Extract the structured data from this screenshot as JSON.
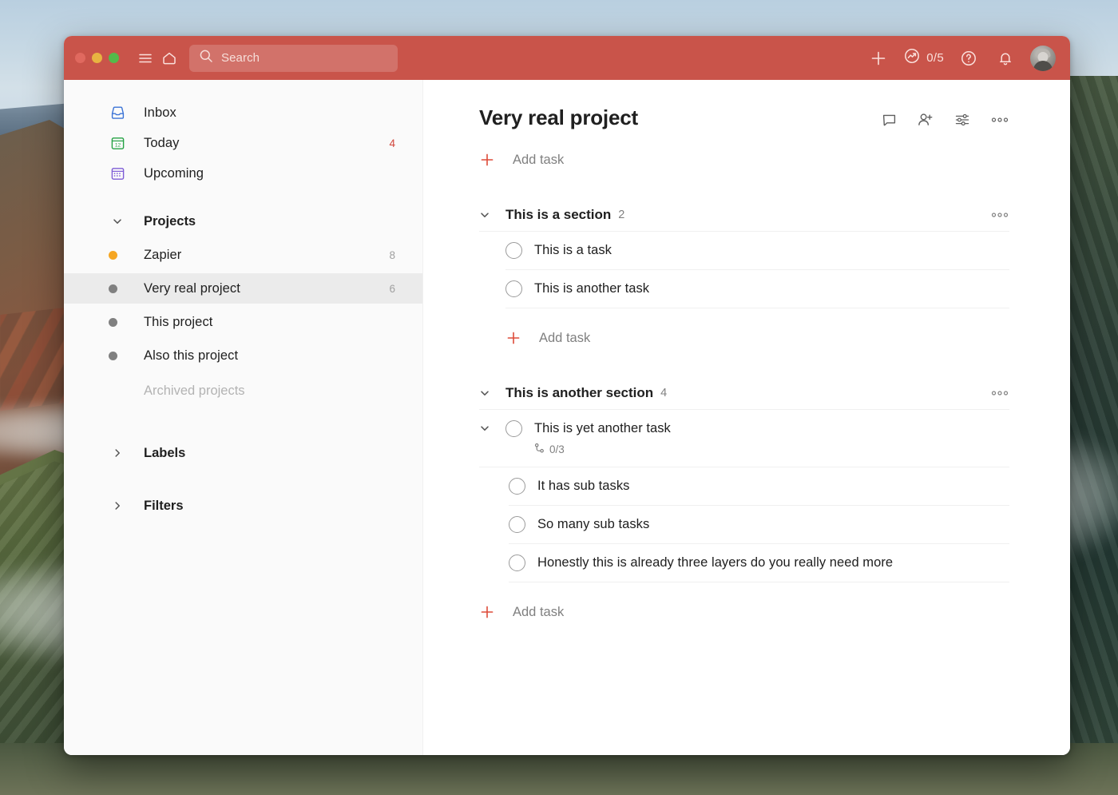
{
  "window": {
    "traffic_lights": [
      "close",
      "minimize",
      "zoom"
    ]
  },
  "titlebar": {
    "menu_icon": "hamburger-menu-icon",
    "home_icon": "home-icon",
    "search": {
      "icon": "search-icon",
      "placeholder": "Search",
      "value": ""
    },
    "add_icon": "plus-icon",
    "karma": {
      "icon": "productivity-trend-icon",
      "count": "0/5"
    },
    "help_icon": "help-circle-icon",
    "notifications_icon": "bell-icon",
    "avatar": "user-avatar",
    "accent_color": "#c9544a"
  },
  "sidebar": {
    "nav": [
      {
        "label": "Inbox",
        "icon": "inbox-icon",
        "count": "",
        "icon_color": "#3b73d6"
      },
      {
        "label": "Today",
        "icon": "today-calendar-icon",
        "count": "4",
        "icon_color": "#25a244",
        "count_accent": true
      },
      {
        "label": "Upcoming",
        "icon": "upcoming-calendar-icon",
        "count": "",
        "icon_color": "#7e5cd6"
      }
    ],
    "projects_group": {
      "label": "Projects",
      "expanded": true,
      "items": [
        {
          "label": "Zapier",
          "count": "8",
          "color": "#f5a623",
          "selected": false
        },
        {
          "label": "Very real project",
          "count": "6",
          "color": "#808080",
          "selected": true
        },
        {
          "label": "This project",
          "count": "",
          "color": "#808080",
          "selected": false
        },
        {
          "label": "Also this project",
          "count": "",
          "color": "#808080",
          "selected": false
        }
      ],
      "archived_label": "Archived projects"
    },
    "labels_group": {
      "label": "Labels",
      "expanded": false
    },
    "filters_group": {
      "label": "Filters",
      "expanded": false
    }
  },
  "main": {
    "title": "Very real project",
    "actions": [
      {
        "name": "comments-icon"
      },
      {
        "name": "add-person-icon"
      },
      {
        "name": "view-options-icon"
      },
      {
        "name": "more-options-icon"
      }
    ],
    "add_task_label": "Add task",
    "sections": [
      {
        "title": "This is a section",
        "count": "2",
        "tasks": [
          {
            "text": "This is a task"
          },
          {
            "text": "This is another task"
          }
        ],
        "add_task_label": "Add task"
      },
      {
        "title": "This is another section",
        "count": "4",
        "tasks": [
          {
            "text": "This is yet another task",
            "subtask_count": "0/3",
            "subtasks": [
              {
                "text": "It has sub tasks"
              },
              {
                "text": "So many sub tasks"
              },
              {
                "text": "Honestly this is already three layers do you really need more"
              }
            ]
          }
        ],
        "add_task_label": "Add task"
      }
    ]
  }
}
